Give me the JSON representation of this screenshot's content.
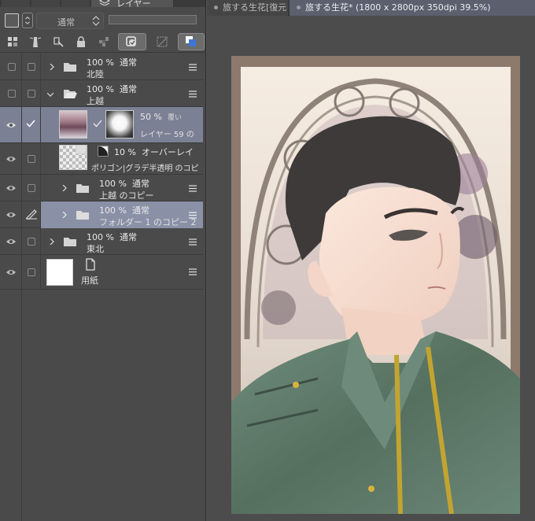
{
  "layer_panel": {
    "tab_label": "レイヤー",
    "blend_mode": "通常",
    "layers": [
      {
        "opacity": "100 %",
        "mode": "通常",
        "name": "北陸"
      },
      {
        "opacity": "100 %",
        "mode": "通常",
        "name": "上越"
      },
      {
        "opacity": "50 %",
        "mode": "覆い",
        "name": "レイヤー 59 の"
      },
      {
        "opacity": "10 %",
        "mode": "オーバーレイ",
        "name": "ポリゴン|グラデ半透明 のコピ"
      },
      {
        "opacity": "100 %",
        "mode": "通常",
        "name": "上越 のコピー"
      },
      {
        "opacity": "100 %",
        "mode": "通常",
        "name": "フォルダー 1 のコピー 2"
      },
      {
        "opacity": "100 %",
        "mode": "通常",
        "name": "東北"
      },
      {
        "name": "用紙"
      }
    ]
  },
  "document_tabs": [
    {
      "label": "旅する生花[復元"
    },
    {
      "label": "旅する生花* (1800 x 2800px 350dpi 39.5%)"
    }
  ],
  "colors": {
    "panel_bg": "#4a4a4a",
    "selected_row": "#7b8094",
    "canvas_bg": "#4c4c4c",
    "active_tab": "#5b5f6e"
  }
}
